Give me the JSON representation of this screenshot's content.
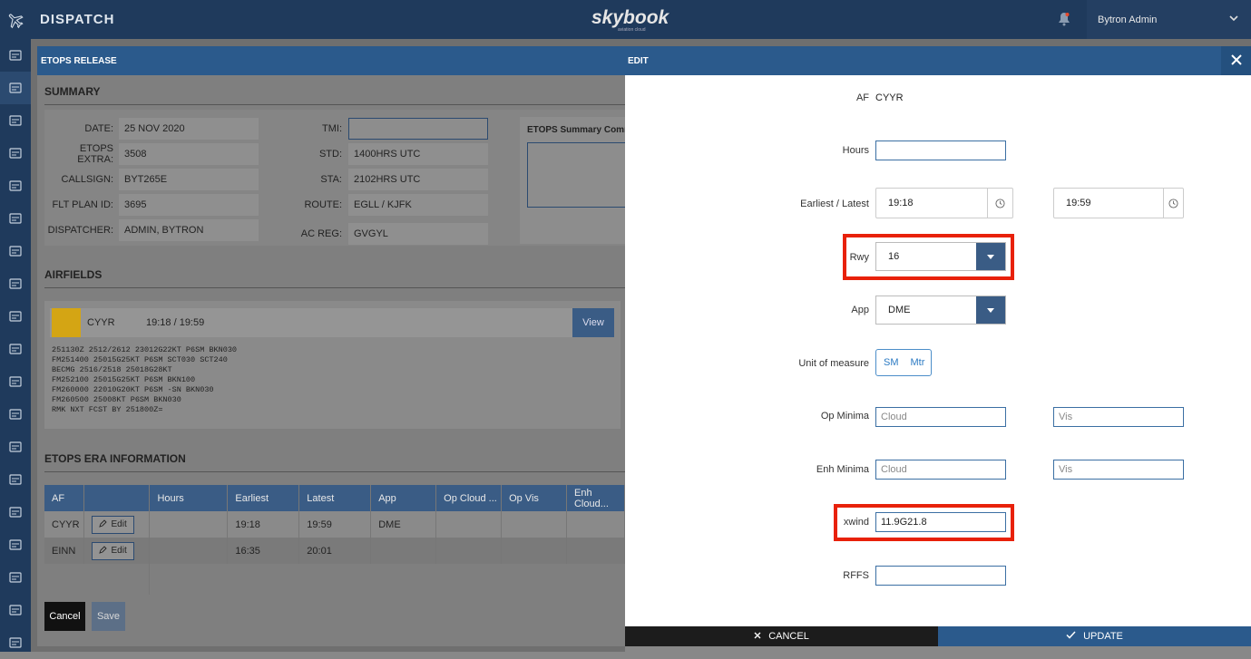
{
  "topbar": {
    "app_title": "DISPATCH",
    "brand": "skybook",
    "brand_sub": "aviation cloud",
    "user": "Bytron Admin"
  },
  "sidebar": {
    "icons": [
      "grid-icon",
      "plane-icon",
      "route-icon",
      "monitor-icon",
      "document-icon",
      "network-icon",
      "weather-icon",
      "pin-icon",
      "safe-icon",
      "checklist-icon",
      "library-icon",
      "display-icon",
      "settings-icon",
      "user-icon",
      "file-icon",
      "screens-icon",
      "warning-icon",
      "tool-icon",
      "sliders-icon"
    ]
  },
  "left": {
    "panel_title": "ETOPS RELEASE",
    "summary_title": "SUMMARY",
    "summary_left": [
      {
        "label": "DATE:",
        "value": "25 NOV 2020"
      },
      {
        "label": "ETOPS EXTRA:",
        "value": "3508"
      },
      {
        "label": "CALLSIGN:",
        "value": "BYT265E"
      },
      {
        "label": "FLT PLAN ID:",
        "value": "3695"
      },
      {
        "label": "DISPATCHER:",
        "value": "ADMIN, BYTRON"
      }
    ],
    "summary_right": [
      {
        "label": "TMI:",
        "value": ""
      },
      {
        "label": "STD:",
        "value": "1400HRS UTC"
      },
      {
        "label": "STA:",
        "value": "2102HRS UTC"
      },
      {
        "label": "ROUTE:",
        "value": "EGLL / KJFK"
      },
      {
        "label": "AC REG:",
        "value": "GVGYL"
      }
    ],
    "comment_title": "ETOPS Summary Comm",
    "airfields_title": "AIRFIELDS",
    "airfield": {
      "code": "CYYR",
      "times": "19:18 / 19:59",
      "view_label": "View",
      "status_color": "#d4a514",
      "metar": "251130Z 2512/2612 23012G22KT P6SM BKN030\nFM251400 25015G25KT P6SM SCT030 SCT240\nBECMG 2516/2518 25018G28KT\nFM252100 25015G25KT P6SM BKN100\nFM260000 22010G20KT P6SM -SN BKN030\nFM260500 25008KT P6SM BKN030\nRMK NXT FCST BY 251800Z="
    },
    "era_title": "ETOPS ERA INFORMATION",
    "era_headers": [
      "AF",
      "",
      "Hours",
      "Earliest",
      "Latest",
      "App",
      "Op Cloud ...",
      "Op Vis",
      "Enh Cloud..."
    ],
    "era_rows": [
      {
        "af": "CYYR",
        "edit": "Edit",
        "hours": "",
        "earliest": "19:18",
        "latest": "19:59",
        "app": "DME"
      },
      {
        "af": "EINN",
        "edit": "Edit",
        "hours": "",
        "earliest": "16:35",
        "latest": "20:01",
        "app": ""
      }
    ],
    "cancel_label": "Cancel",
    "save_label": "Save"
  },
  "edit": {
    "title": "EDIT",
    "af_label": "AF",
    "af_value": "CYYR",
    "hours_label": "Hours",
    "hours_value": "",
    "earliest_latest_label": "Earliest / Latest",
    "earliest": "19:18",
    "latest": "19:59",
    "rwy_label": "Rwy",
    "rwy_value": "16",
    "app_label": "App",
    "app_value": "DME",
    "unit_label": "Unit of measure",
    "unit_options": [
      "SM",
      "Mtr"
    ],
    "op_minima_label": "Op Minima",
    "op_cloud_ph": "Cloud",
    "op_vis_ph": "Vis",
    "enh_minima_label": "Enh Minima",
    "enh_cloud_ph": "Cloud",
    "enh_vis_ph": "Vis",
    "xwind_label": "xwind",
    "xwind_value": "11.9G21.8",
    "rffs_label": "RFFS",
    "rffs_value": "",
    "cancel_label": "CANCEL",
    "update_label": "UPDATE",
    "highlight_color": "#e8210a"
  }
}
